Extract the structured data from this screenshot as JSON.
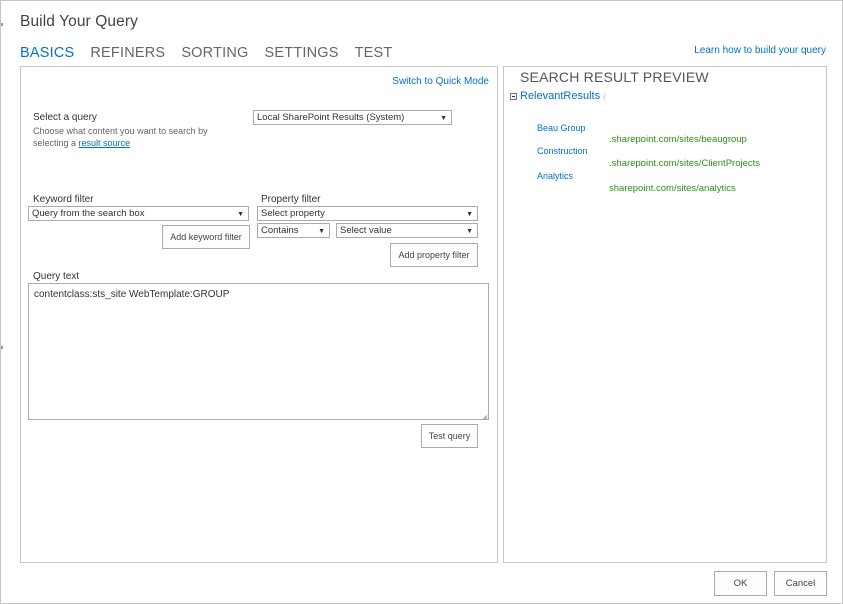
{
  "dialog": {
    "title": "Build Your Query",
    "help_link": "Learn how to build your query"
  },
  "tabs": [
    {
      "label": "BASICS",
      "active": true
    },
    {
      "label": "REFINERS",
      "active": false
    },
    {
      "label": "SORTING",
      "active": false
    },
    {
      "label": "SETTINGS",
      "active": false
    },
    {
      "label": "TEST",
      "active": false
    }
  ],
  "basics": {
    "switch_mode_link": "Switch to Quick Mode",
    "select_query": {
      "label": "Select a query",
      "description_pre": "Choose what content you want to search by selecting a",
      "description_link": "result source",
      "value": "Local SharePoint Results (System)"
    },
    "keyword_filter": {
      "label": "Keyword filter",
      "value": "Query from the search box",
      "add_button": "Add keyword filter"
    },
    "property_filter": {
      "label": "Property filter",
      "property_value": "Select property",
      "operator_value": "Contains",
      "value_value": "Select value",
      "add_button": "Add property filter"
    },
    "query_text": {
      "label": "Query text",
      "value": "contentclass:sts_site WebTemplate:GROUP"
    },
    "test_button": "Test query"
  },
  "preview": {
    "title": "SEARCH RESULT PREVIEW",
    "group_label": "RelevantResults",
    "group_tick": "(",
    "results": [
      {
        "title": "Beau Group",
        "url": ".sharepoint.com/sites/beaugroup"
      },
      {
        "title": "Construction",
        "url": ".sharepoint.com/sites/ClientProjects"
      },
      {
        "title": "Analytics",
        "url": "sharepoint.com/sites/analytics"
      }
    ]
  },
  "footer": {
    "ok": "OK",
    "cancel": "Cancel"
  },
  "colors": {
    "accent": "#0072c6",
    "url_green": "#2b9311",
    "border": "#c6c6c6"
  },
  "icons": {
    "dropdown": "caret-down",
    "tree_toggle": "collapse-box"
  }
}
